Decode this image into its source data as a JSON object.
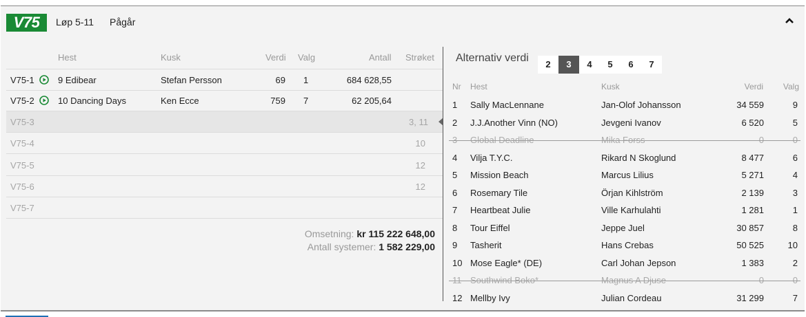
{
  "header": {
    "logo": "V75",
    "race_label": "Løp 5-11",
    "status": "Pågår"
  },
  "left_table": {
    "columns": {
      "hest": "Hest",
      "kusk": "Kusk",
      "verdi": "Verdi",
      "valg": "Valg",
      "antall": "Antall",
      "stroket": "Strøket"
    },
    "rows": [
      {
        "id": "V75-1",
        "hest": "9 Edibear",
        "kusk": "Stefan Persson",
        "verdi": "69",
        "valg": "1",
        "antall": "684 628,55",
        "stroket": ""
      },
      {
        "id": "V75-2",
        "hest": "10 Dancing Days",
        "kusk": "Ken Ecce",
        "verdi": "759",
        "valg": "7",
        "antall": "62 205,64",
        "stroket": ""
      },
      {
        "id": "V75-3",
        "hest": "",
        "kusk": "",
        "verdi": "",
        "valg": "",
        "antall": "",
        "stroket": "3, 11"
      },
      {
        "id": "V75-4",
        "hest": "",
        "kusk": "",
        "verdi": "",
        "valg": "",
        "antall": "",
        "stroket": "10"
      },
      {
        "id": "V75-5",
        "hest": "",
        "kusk": "",
        "verdi": "",
        "valg": "",
        "antall": "",
        "stroket": "12"
      },
      {
        "id": "V75-6",
        "hest": "",
        "kusk": "",
        "verdi": "",
        "valg": "",
        "antall": "",
        "stroket": "12"
      },
      {
        "id": "V75-7",
        "hest": "",
        "kusk": "",
        "verdi": "",
        "valg": "",
        "antall": "",
        "stroket": ""
      }
    ]
  },
  "summary": {
    "omsetning_label": "Omsetning:",
    "omsetning_value": "kr 115 222 648,00",
    "systemer_label": "Antall systemer:",
    "systemer_value": "1 582 229,00"
  },
  "alternativ": {
    "title": "Alternativ verdi",
    "buttons": [
      "2",
      "3",
      "4",
      "5",
      "6",
      "7"
    ],
    "active": "3",
    "columns": {
      "nr": "Nr",
      "hest": "Hest",
      "kusk": "Kusk",
      "verdi": "Verdi",
      "valg": "Valg"
    },
    "rows": [
      {
        "nr": "1",
        "hest": "Sally MacLennane",
        "kusk": "Jan-Olof Johansson",
        "verdi": "34 559",
        "valg": "9",
        "scratched": false
      },
      {
        "nr": "2",
        "hest": "J.J.Another Vinn (NO)",
        "kusk": "Jevgeni Ivanov",
        "verdi": "6 520",
        "valg": "5",
        "scratched": false
      },
      {
        "nr": "3",
        "hest": "Global Deadline",
        "kusk": "Mika Forss",
        "verdi": "0",
        "valg": "0",
        "scratched": true
      },
      {
        "nr": "4",
        "hest": "Vilja T.Y.C.",
        "kusk": "Rikard N Skoglund",
        "verdi": "8 477",
        "valg": "6",
        "scratched": false
      },
      {
        "nr": "5",
        "hest": "Mission Beach",
        "kusk": "Marcus Lilius",
        "verdi": "5 271",
        "valg": "4",
        "scratched": false
      },
      {
        "nr": "6",
        "hest": "Rosemary Tile",
        "kusk": "Örjan Kihlström",
        "verdi": "2 139",
        "valg": "3",
        "scratched": false
      },
      {
        "nr": "7",
        "hest": "Heartbeat Julie",
        "kusk": "Ville Karhulahti",
        "verdi": "1 281",
        "valg": "1",
        "scratched": false
      },
      {
        "nr": "8",
        "hest": "Tour Eiffel",
        "kusk": "Jeppe Juel",
        "verdi": "30 857",
        "valg": "8",
        "scratched": false
      },
      {
        "nr": "9",
        "hest": "Tasherit",
        "kusk": "Hans Crebas",
        "verdi": "50 525",
        "valg": "10",
        "scratched": false
      },
      {
        "nr": "10",
        "hest": "Mose Eagle* (DE)",
        "kusk": "Carl Johan Jepson",
        "verdi": "1 383",
        "valg": "2",
        "scratched": false
      },
      {
        "nr": "11",
        "hest": "Southwind Boko*",
        "kusk": "Magnus A Djuse",
        "verdi": "0",
        "valg": "0",
        "scratched": true
      },
      {
        "nr": "12",
        "hest": "Mellby Ivy",
        "kusk": "Julian Cordeau",
        "verdi": "31 299",
        "valg": "7",
        "scratched": false
      }
    ]
  },
  "colors": {
    "brand": "#1a8a35",
    "active_button": "#555555",
    "bottom_tab": "#1e6fb5"
  }
}
